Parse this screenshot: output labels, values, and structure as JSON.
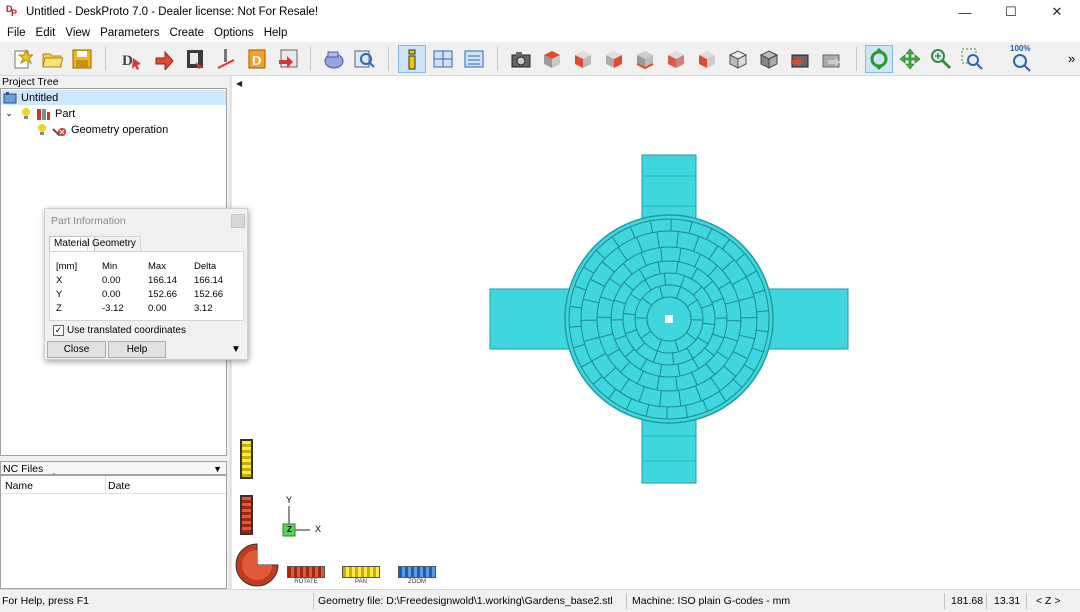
{
  "titlebar": {
    "title": "Untitled - DeskProto 7.0 - Dealer license: Not For Resale!",
    "minimize": "—",
    "maximize": "☐",
    "close": "✕"
  },
  "menu": [
    "File",
    "Edit",
    "View",
    "Parameters",
    "Create",
    "Options",
    "Help"
  ],
  "toolbar": {
    "zoom_100_label": "100%",
    "more": "»"
  },
  "project_tree": {
    "header": "Project Tree",
    "root": "Untitled",
    "part": "Part",
    "operation": "Geometry operation"
  },
  "nc_files": {
    "header": "NC Files",
    "col_name": "Name",
    "col_date": "Date"
  },
  "part_info": {
    "title": "Part Information",
    "tabs": [
      "Material",
      "Geometry"
    ],
    "headers": [
      "[mm]",
      "Min",
      "Max",
      "Delta"
    ],
    "rows": [
      [
        "X",
        "0.00",
        "166.14",
        "166.14"
      ],
      [
        "Y",
        "0.00",
        "152.66",
        "152.66"
      ],
      [
        "Z",
        "-3.12",
        "0.00",
        "3.12"
      ]
    ],
    "checkbox_label": "Use translated coordinates",
    "checkbox_checked": true,
    "close_button": "Close",
    "help_button": "Help"
  },
  "viewport": {
    "axis_y": "Y",
    "axis_z": "Z",
    "axis_x": "X",
    "model_color": "#3fd6de",
    "rotate_label": "ROTATE",
    "pan_label": "PAN",
    "zoom_label": "ZOOM"
  },
  "statusbar": {
    "help": "For Help, press F1",
    "geometry_file": "Geometry file: D:\\Freedesignwold\\1.working\\Gardens_base2.stl",
    "machine": "Machine: ISO plain G-codes - mm",
    "coord_x": "181.68",
    "coord_y": "13.31",
    "axis": "< Z >"
  }
}
